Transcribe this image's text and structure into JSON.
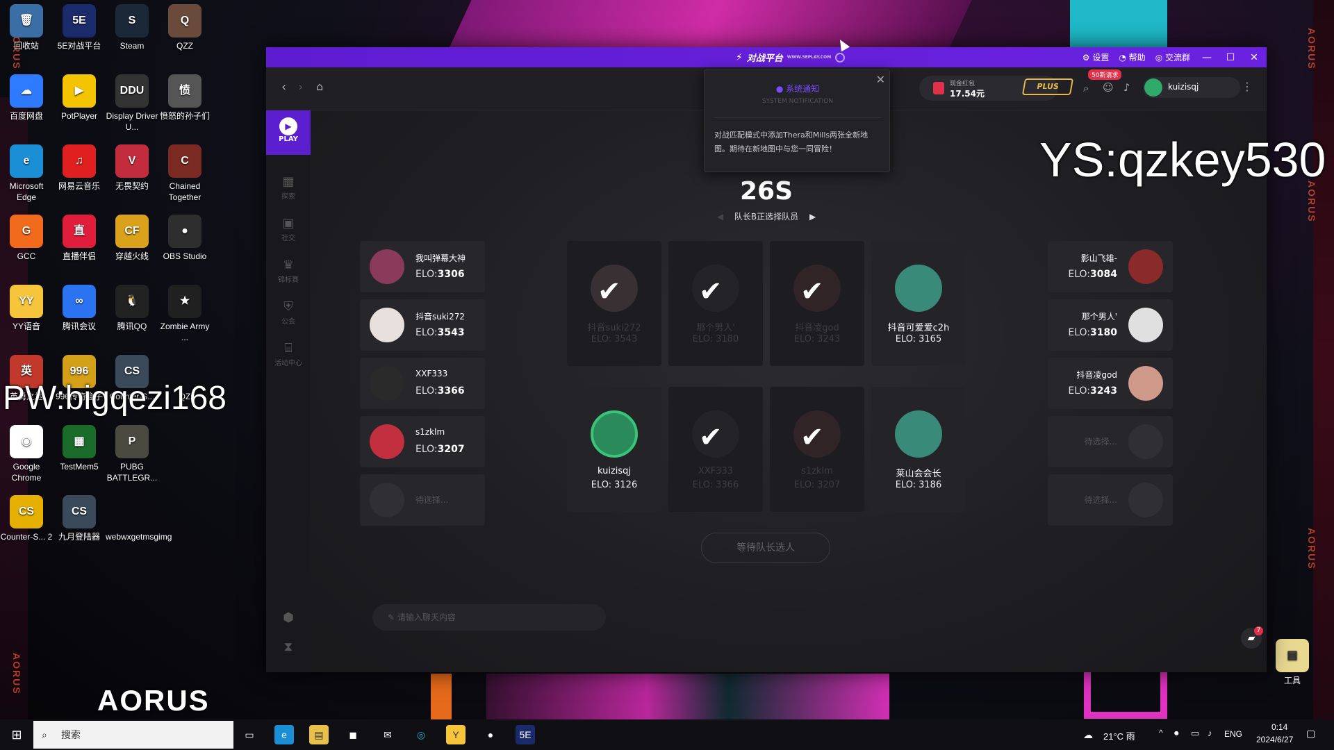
{
  "desktop": {
    "icons": [
      {
        "label": "回收站",
        "color": "#3a6ea5",
        "glyph": "🗑"
      },
      {
        "label": "5E对战平台",
        "color": "#1b2a6b",
        "glyph": "5E"
      },
      {
        "label": "Steam",
        "color": "#1b2838",
        "glyph": "S"
      },
      {
        "label": "QZZ",
        "color": "#6a4a3a",
        "glyph": "Q"
      },
      {
        "label": "百度网盘",
        "color": "#2f7bff",
        "glyph": "☁"
      },
      {
        "label": "PotPlayer",
        "color": "#f5c400",
        "glyph": "▶"
      },
      {
        "label": "Display Driver U...",
        "color": "#333",
        "glyph": "DDU"
      },
      {
        "label": "愤怒的孙子们",
        "color": "#555",
        "glyph": "愤"
      },
      {
        "label": "Microsoft Edge",
        "color": "#1a8fd6",
        "glyph": "e"
      },
      {
        "label": "网易云音乐",
        "color": "#e02020",
        "glyph": "♫"
      },
      {
        "label": "无畏契约",
        "color": "#c22c3c",
        "glyph": "V"
      },
      {
        "label": "Chained Together",
        "color": "#7a2a20",
        "glyph": "C"
      },
      {
        "label": "GCC",
        "color": "#f26b1d",
        "glyph": "G"
      },
      {
        "label": "直播伴侣",
        "color": "#e01e3c",
        "glyph": "直"
      },
      {
        "label": "穿越火线",
        "color": "#d9a21a",
        "glyph": "CF"
      },
      {
        "label": "OBS Studio",
        "color": "#2e2e2e",
        "glyph": "●"
      },
      {
        "label": "YY语音",
        "color": "#f6c53b",
        "glyph": "YY"
      },
      {
        "label": "腾讯会议",
        "color": "#2b73f0",
        "glyph": "∞"
      },
      {
        "label": "腾讯QQ",
        "color": "#222",
        "glyph": "🐧"
      },
      {
        "label": "Zombie Army ...",
        "color": "#202020",
        "glyph": "★"
      },
      {
        "label": "英勇之地",
        "color": "#c0392b",
        "glyph": "英"
      },
      {
        "label": "996传奇盒子",
        "color": "#d4a017",
        "glyph": "996"
      },
      {
        "label": "Counter-S...",
        "color": "#3a4a5a",
        "glyph": "CS"
      },
      {
        "label": "QZ",
        "color": "transparent",
        "glyph": ""
      },
      {
        "label": "Google Chrome",
        "color": "#ffffff",
        "glyph": "◉"
      },
      {
        "label": "TestMem5",
        "color": "#1a6b2a",
        "glyph": "▦"
      },
      {
        "label": "PUBG BATTLEGR...",
        "color": "#4a4a40",
        "glyph": "P"
      },
      {
        "label": "Counter-S... 2",
        "color": "#e5b000",
        "glyph": "CS"
      },
      {
        "label": "九月登陆器",
        "color": "#3a4a5a",
        "glyph": "CS"
      },
      {
        "label": "webwxgetmsgimg",
        "color": "transparent",
        "glyph": ""
      }
    ],
    "tools_label": "工具",
    "overlay_pw": "PW:bigqezi168",
    "overlay_ys": "YS:qzkey530",
    "aorus": "AORUS"
  },
  "app": {
    "title": "对战平台",
    "title_sub": "WWW.5EPLAY.COM",
    "settings": "设置",
    "help": "帮助",
    "community": "交流群",
    "wallet_label": "现金红包",
    "wallet_value": "17.54元",
    "plus": "PLUS",
    "requests_badge": "50新请求",
    "username": "kuizisqj",
    "sidebar": [
      {
        "label": "PLAY"
      },
      {
        "label": "探索"
      },
      {
        "label": "社交"
      },
      {
        "label": "锦标赛"
      },
      {
        "label": "公会"
      },
      {
        "label": "活动中心"
      }
    ],
    "timer": "26S",
    "timer_sub": "队长B正选择队员",
    "notification": {
      "title": "系统通知",
      "subtitle": "SYSTEM NOTIFICATION",
      "body": "对战匹配模式中添加Thera和Mills两张全新地图。期待在新地图中与您一同冒险！"
    },
    "left_pool": [
      {
        "name": "我叫弹幕大神",
        "elo": "3306",
        "color": "#8a3a5a"
      },
      {
        "name": "抖音suki272",
        "elo": "3543",
        "color": "#e8e0dc"
      },
      {
        "name": "XXF333",
        "elo": "3366",
        "color": "#2a2a2a"
      },
      {
        "name": "s1zklm",
        "elo": "3207",
        "color": "#c23040"
      },
      {
        "name": "待选择...",
        "elo": "",
        "color": ""
      }
    ],
    "right_pool": [
      {
        "name": "影山飞雄-",
        "elo": "3084",
        "color": "#8a2a2a"
      },
      {
        "name": "那个男人'",
        "elo": "3180",
        "color": "#e0e0e0"
      },
      {
        "name": "抖音凌god",
        "elo": "3243",
        "color": "#d09a8a"
      },
      {
        "name": "待选择...",
        "elo": "",
        "color": ""
      },
      {
        "name": "待选择...",
        "elo": "",
        "color": ""
      }
    ],
    "slots_top": [
      {
        "name": "抖音suki272",
        "elo": "3543",
        "checked": true
      },
      {
        "name": "那个男人'",
        "elo": "3180",
        "checked": true
      },
      {
        "name": "抖音凌god",
        "elo": "3243",
        "checked": true
      },
      {
        "name": "抖音可爱爱c2h",
        "elo": "3165",
        "checked": false
      }
    ],
    "slots_bottom": [
      {
        "name": "kuizisqj",
        "elo": "3126",
        "checked": false
      },
      {
        "name": "XXF333",
        "elo": "3366",
        "checked": true
      },
      {
        "name": "s1zklm",
        "elo": "3207",
        "checked": true
      },
      {
        "name": "莱山会会长",
        "elo": "3186",
        "checked": false
      }
    ],
    "elo_prefix": "ELO:",
    "wait_button": "等待队长选人",
    "chat_placeholder": "请输入聊天内容",
    "chat_badge": "7"
  },
  "taskbar": {
    "search_placeholder": "搜索",
    "weather": "21°C 雨",
    "lang": "ENG",
    "time": "0:14",
    "date": "2024/6/27"
  }
}
